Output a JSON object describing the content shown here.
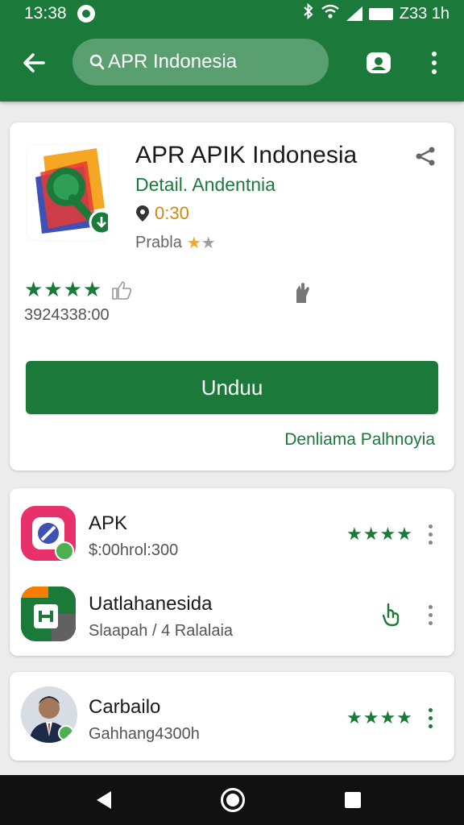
{
  "status_bar": {
    "time": "13:38",
    "right_text": "Z33 1h"
  },
  "header": {
    "search_text": "APR Indonesia"
  },
  "app": {
    "title": "APR APIK Indonesia",
    "developer": "Detail. Andentnia",
    "time_label": "0:30",
    "rating_label": "Prabla",
    "stars": "★★★★",
    "count": "3924338:00",
    "install_label": "Unduu",
    "link_label": "Denliama Palhnoyia"
  },
  "related": [
    {
      "title": "APK",
      "subtitle": "$:00hrol:300",
      "stars": "★★★★"
    },
    {
      "title": "Uatlahanesida",
      "subtitle": "Slaapah / 4 Ralalaia"
    },
    {
      "title": "Carbailo",
      "subtitle": "Gahhang4300h",
      "stars": "★★★★"
    }
  ],
  "colors": {
    "primary": "#1b7a3a",
    "accent_orange": "#f5a623",
    "star_gray": "#9e9e9e"
  }
}
